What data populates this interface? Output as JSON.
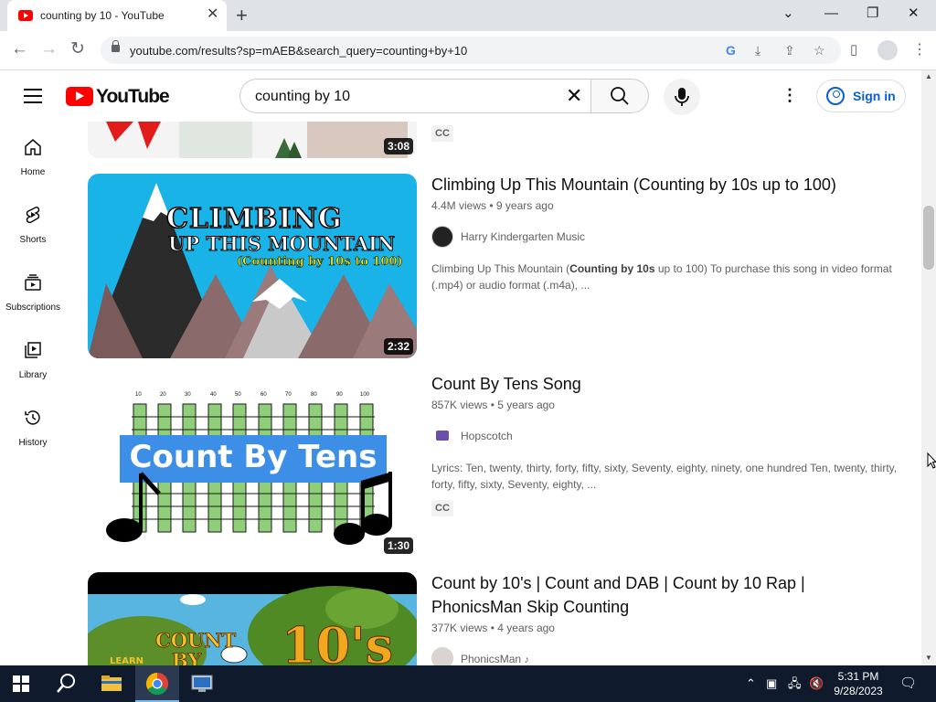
{
  "browser": {
    "tab_title": "counting by 10 - YouTube",
    "url": "youtube.com/results?sp=mAEB&search_query=counting+by+10"
  },
  "header": {
    "logo_text": "YouTube",
    "search_value": "counting by 10",
    "signin_label": "Sign in"
  },
  "sidebar": {
    "items": [
      {
        "label": "Home",
        "icon": "home-icon"
      },
      {
        "label": "Shorts",
        "icon": "shorts-icon"
      },
      {
        "label": "Subscriptions",
        "icon": "subscriptions-icon"
      },
      {
        "label": "Library",
        "icon": "library-icon"
      },
      {
        "label": "History",
        "icon": "history-icon"
      }
    ]
  },
  "results": {
    "partial_top": {
      "duration": "3:08",
      "cc": "CC"
    },
    "videos": [
      {
        "title": "Climbing Up This Mountain (Counting by 10s up to 100)",
        "views": "4.4M views",
        "age": "9 years ago",
        "channel": "Harry Kindergarten Music",
        "desc_before": "Climbing Up This Mountain (",
        "desc_bold": "Counting by 10s",
        "desc_after": " up to 100) To purchase this song in video format (.mp4) or audio format (.m4a), ...",
        "duration": "2:32",
        "thumb_line1": "CLIMBING",
        "thumb_line2": "UP THIS MOUNTAIN",
        "thumb_line3": "(Counting by 10s to 100)"
      },
      {
        "title": "Count By Tens Song",
        "views": "857K views",
        "age": "5 years ago",
        "channel": "Hopscotch",
        "desc": "Lyrics: Ten, twenty, thirty, forty, fifty, sixty, Seventy, eighty, ninety, one hundred Ten, twenty, thirty, forty, fifty, sixty, Seventy, eighty, ...",
        "cc": "CC",
        "duration": "1:30",
        "thumb_text": "Count By Tens",
        "thumb_numbers": [
          "10",
          "20",
          "30",
          "40",
          "50",
          "60",
          "70",
          "80",
          "90",
          "100"
        ]
      },
      {
        "title": "Count by 10's | Count and DAB | Count by 10 Rap | PhonicsMan Skip Counting",
        "views": "377K views",
        "age": "4 years ago",
        "channel": "PhonicsMan",
        "thumb_line1": "COUNT",
        "thumb_line2": "BY",
        "thumb_big": "10's",
        "thumb_small": "LEARN"
      }
    ]
  },
  "taskbar": {
    "time": "5:31 PM",
    "date": "9/28/2023"
  },
  "colors": {
    "yt_red": "#ff0000",
    "link_blue": "#065fd4",
    "taskbar": "#0f1b2d"
  }
}
